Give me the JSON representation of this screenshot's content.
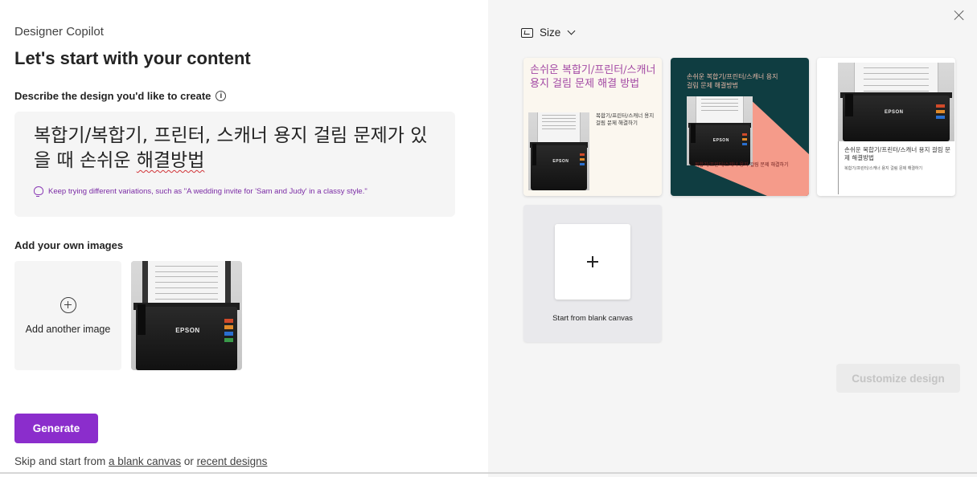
{
  "app": {
    "title": "Designer Copilot",
    "heading": "Let's start with your content"
  },
  "describe": {
    "label": "Describe the design you'd like to create",
    "info_icon": "info-icon",
    "prompt_main": "복합기/복합기, 프린터, 스캐너 용지 걸림 문제가 있을 때 손쉬운 ",
    "prompt_misspelled": "해결방법",
    "hint": "Keep trying different variations, such as \"A wedding invite for 'Sam and Judy' in a classy style.\"",
    "hint_icon": "lightbulb-icon"
  },
  "images": {
    "label": "Add your own images",
    "add_label": "Add another image",
    "add_icon": "add-circle-icon",
    "uploaded": [
      {
        "alt": "EPSON scanner photo",
        "brand": "EPSON"
      }
    ]
  },
  "actions": {
    "generate": "Generate",
    "skip_prefix": "Skip and start from ",
    "blank_canvas_link": "a blank canvas",
    "or": " or ",
    "recent_designs_link": "recent designs"
  },
  "right_panel": {
    "size_label": "Size",
    "size_icon": "resize-icon",
    "close_icon": "close-icon",
    "designs": [
      {
        "title": "손쉬운 복합기/프린터/스캐너 용지 걸림 문제 해결 방법",
        "subtitle": "복합기/프린터/스캐너 용지 걸림 문제 해결하기",
        "brand": "EPSON",
        "colors": {
          "bg": "#fbf7ef",
          "title": "#a349a4"
        }
      },
      {
        "title": "손쉬운 복합기/프린터/스캐너 용지 걸림 문제 해결방법",
        "subtitle": "복합기/프린터/스캐너 용지 걸림 문제 해결하기",
        "brand": "EPSON",
        "colors": {
          "bg": "#0f3d41",
          "accent": "#f59b8a"
        }
      },
      {
        "title": "손쉬운 복합기/프린터/스캐너 용지 걸림 문제 해결방법",
        "subtitle": "복합기/프린터/스캐너 용지 걸림 문제 해결하기",
        "brand": "EPSON",
        "colors": {
          "bg": "#ffffff"
        }
      }
    ],
    "blank_canvas_label": "Start from blank canvas",
    "customize_label": "Customize design"
  },
  "colors": {
    "accent": "#8b2dcc",
    "hint_text": "#7a2ba5",
    "panel_bg": "#f5f5f5"
  }
}
